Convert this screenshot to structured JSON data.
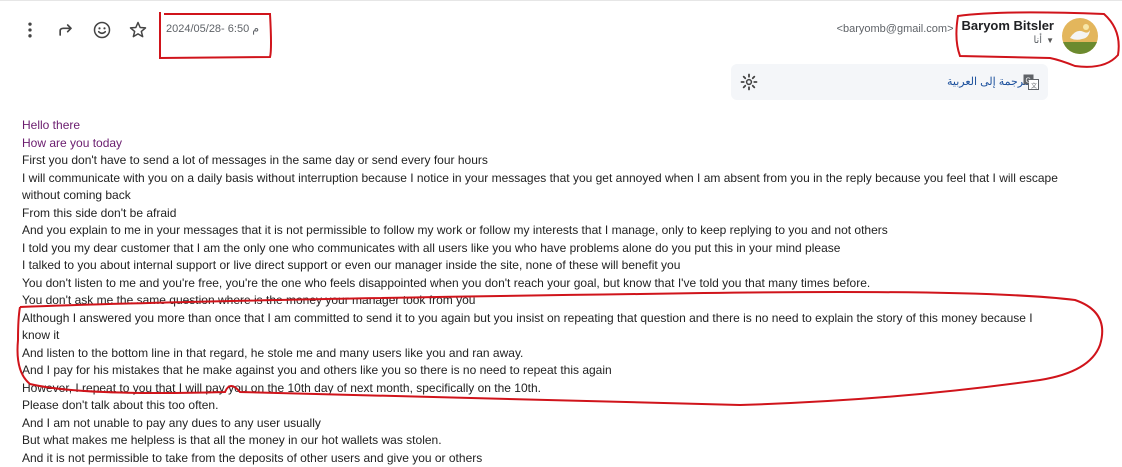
{
  "header": {
    "datetime": "2024/05/28- 6:50 م",
    "sender_email": "<baryomb@gmail.com>",
    "sender_name": "Baryom Bitsler",
    "to_label": "أنا",
    "toolbar": {
      "more_icon": "more-vert-icon",
      "reply_icon": "reply-icon",
      "emoji_icon": "emoji-icon",
      "star_icon": "star-icon"
    }
  },
  "translate": {
    "label": "الترجمة إلى العربية"
  },
  "body": {
    "greeting_lines": [
      "Hello there",
      "How are you today"
    ],
    "lines": [
      "First you don't have to send a lot of messages in the same day or send every four hours",
      "I will communicate with you on a daily basis without interruption because I notice in your messages that you get annoyed when I am absent from you in the reply because you feel that I will escape without coming back",
      "From this side don't be afraid",
      "And you explain to me in your messages that it is not permissible to follow my work or follow my interests that I manage, only to keep replying to you and not others",
      "I told you my dear customer that I am the only one who communicates with all users like you who have problems alone do you put this in your mind please",
      "I talked to you about internal support or live direct support or even our manager inside the site, none of these will benefit you",
      "You don't listen to me and you're free, you're the one who feels disappointed when you don't reach your goal, but know that I've told you that many times before.",
      "You don't ask me the same question where is the money your manager took from you",
      "Although I answered you more than once that I am committed to send it to you again but you insist on repeating that question and there is no need to explain the story of this money because I know it",
      "And listen to the bottom line in that regard, he stole me and many users like you and ran away.",
      "And I pay for his mistakes that he make against you and others like you so there is no need to repeat this again",
      "However, I repeat to you that I will pay you on the 10th day of next month, specifically on the 10th.",
      "Please don't talk about this too often.",
      "And I am not unable to pay any dues to any user usually",
      "But what makes me helpless is that all the money in our hot wallets was stolen.",
      "And it is not permissible to take from the deposits of other users and give you or others"
    ]
  },
  "colors": {
    "annotation_red": "#d0141b",
    "greeting_purple": "#6a1b6e",
    "translate_bg": "#f4f6f9"
  }
}
